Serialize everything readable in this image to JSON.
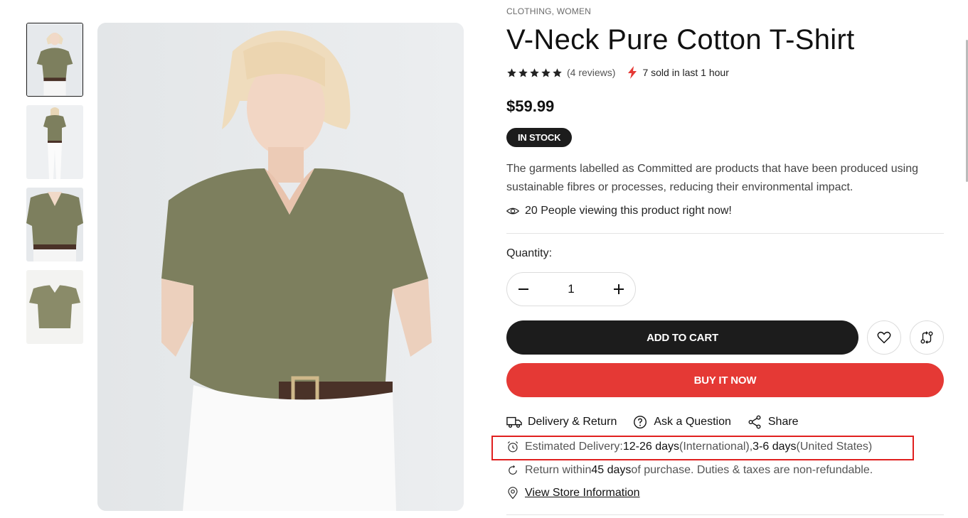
{
  "breadcrumb": {
    "cat1": "CLOTHING",
    "sep": ",",
    "cat2": "WOMEN"
  },
  "product": {
    "title": "V-Neck Pure Cotton T-Shirt",
    "rating_stars": 5,
    "reviews": "(4 reviews)",
    "sold": "7 sold in last 1 hour",
    "price": "$59.99",
    "stock": "IN STOCK",
    "description": "The garments labelled as Committed are products that have been produced using sustainable fibres or processes, reducing their environmental impact.",
    "viewing": "20 People viewing this product right now!"
  },
  "quantity": {
    "label": "Quantity:",
    "value": "1"
  },
  "buttons": {
    "add_to_cart": "ADD TO CART",
    "buy_now": "BUY IT NOW"
  },
  "links": {
    "delivery": "Delivery & Return",
    "ask": "Ask a Question",
    "share": "Share"
  },
  "delivery": {
    "prefix": "Estimated Delivery: ",
    "intl_days": "12-26 days",
    "intl_label": " (International), ",
    "us_days": "3-6 days",
    "us_label": " (United States)"
  },
  "returns": {
    "prefix": "Return within ",
    "days": "45 days",
    "suffix": " of purchase. Duties & taxes are non-refundable."
  },
  "store": {
    "link": "View Store Information"
  },
  "colors": {
    "accent_red": "#e53935",
    "dark": "#1c1c1c",
    "shirt_olive": "#7d7f5e",
    "highlight_box": "#e0201f"
  },
  "icons": [
    "star-icon",
    "bolt-icon",
    "eye-icon",
    "minus-icon",
    "plus-icon",
    "heart-icon",
    "compare-icon",
    "truck-icon",
    "question-icon",
    "share-icon",
    "clock-icon",
    "return-icon",
    "location-pin-icon"
  ]
}
